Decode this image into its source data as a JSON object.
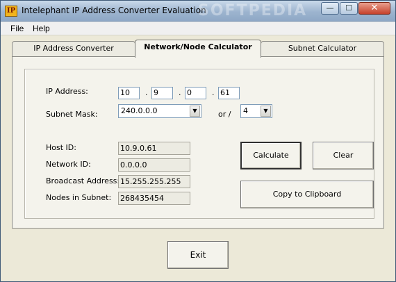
{
  "window": {
    "title": "Intelephant IP Address Converter Evaluation",
    "icon_text": "IP",
    "watermark": "SOFTPEDIA",
    "controls": {
      "minimize": "—",
      "maximize": "☐",
      "close": "✕"
    }
  },
  "menu": [
    "File",
    "Help"
  ],
  "tabs": [
    {
      "label": "IP Address Converter",
      "active": false
    },
    {
      "label": "Network/Node Calculator",
      "active": true
    },
    {
      "label": "Subnet Calculator",
      "active": false
    }
  ],
  "calculator": {
    "ip_label": "IP Address:",
    "octets": [
      "10",
      "9",
      "0",
      "61"
    ],
    "octet_separator": ".",
    "mask_label": "Subnet Mask:",
    "mask_value": "240.0.0.0",
    "or_label": "or /",
    "prefix_value": "4",
    "results": [
      {
        "label": "Host ID:",
        "value": "10.9.0.61"
      },
      {
        "label": "Network ID:",
        "value": "0.0.0.0"
      },
      {
        "label": "Broadcast Address:",
        "value": "15.255.255.255"
      },
      {
        "label": "Nodes in Subnet:",
        "value": "268435454"
      }
    ],
    "buttons": {
      "calculate": "Calculate",
      "clear": "Clear",
      "copy": "Copy to Clipboard"
    }
  },
  "exit_label": "Exit",
  "colors": {
    "accent_title": "#9db4cf",
    "close_button": "#c7412b"
  },
  "icons": [
    "chevron-down-icon",
    "app-ip-icon"
  ]
}
